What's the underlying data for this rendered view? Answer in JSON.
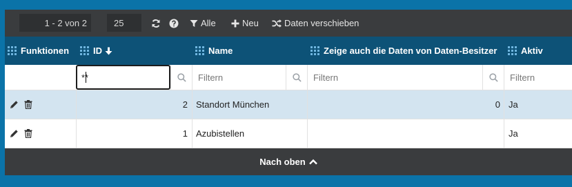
{
  "toolbar": {
    "pager_text": "1 - 2 von 2",
    "page_size": "25",
    "refresh_icon": "refresh-icon",
    "help_icon": "question-circle-icon",
    "filter_label": "Alle",
    "new_label": "Neu",
    "move_label": "Daten verschieben"
  },
  "columns": [
    {
      "label": "Funktionen"
    },
    {
      "label": "ID",
      "sort": "desc"
    },
    {
      "label": "Name"
    },
    {
      "label": "Zeige auch die Daten von Daten-Besitzer"
    },
    {
      "label": "Aktiv"
    }
  ],
  "filters": {
    "id_value": "**",
    "name_placeholder": "Filtern",
    "owner_placeholder": "Filtern",
    "active_placeholder": "Filtern"
  },
  "rows": [
    {
      "id": "2",
      "name": "Standort München",
      "owner_data": "0",
      "active": "Ja"
    },
    {
      "id": "1",
      "name": "Azubistellen",
      "owner_data": "",
      "active": "Ja"
    }
  ],
  "footer": {
    "label": "Nach oben"
  },
  "colors": {
    "page_bg": "#0b73a8",
    "header_bg": "#0d5277",
    "toolbar_bg": "#3a3c3e",
    "selected_row_bg": "#d3e4f0"
  }
}
